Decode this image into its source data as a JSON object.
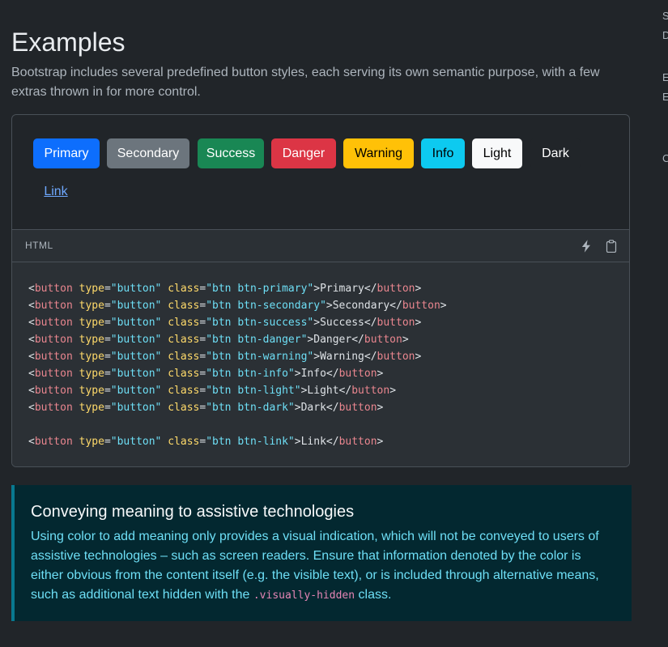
{
  "heading": "Examples",
  "lead": "Bootstrap includes several predefined button styles, each serving its own semantic purpose, with a few extras thrown in for more control.",
  "buttons": {
    "primary": "Primary",
    "secondary": "Secondary",
    "success": "Success",
    "danger": "Danger",
    "warning": "Warning",
    "info": "Info",
    "light": "Light",
    "dark": "Dark",
    "link": "Link"
  },
  "code_header": {
    "language": "HTML",
    "icons": [
      "lightning-icon",
      "clipboard-icon"
    ]
  },
  "code_lines": [
    {
      "cls": "btn btn-primary",
      "label": "Primary"
    },
    {
      "cls": "btn btn-secondary",
      "label": "Secondary"
    },
    {
      "cls": "btn btn-success",
      "label": "Success"
    },
    {
      "cls": "btn btn-danger",
      "label": "Danger"
    },
    {
      "cls": "btn btn-warning",
      "label": "Warning"
    },
    {
      "cls": "btn btn-info",
      "label": "Info"
    },
    {
      "cls": "btn btn-light",
      "label": "Light"
    },
    {
      "cls": "btn btn-dark",
      "label": "Dark"
    },
    {
      "cls": "btn btn-link",
      "label": "Link",
      "gap_before": true
    }
  ],
  "callout": {
    "title": "Conveying meaning to assistive technologies",
    "text_before": "Using color to add meaning only provides a visual indication, which will not be conveyed to users of assistive technologies – such as screen readers. Ensure that information denoted by the color is either obvious from the content itself (e.g. the visible text), or is included through alternative means, such as additional text hidden with the ",
    "code": ".visually-hidden",
    "text_after": " class."
  },
  "sidebar_peek": [
    "S",
    "D",
    "E",
    "E",
    "C"
  ],
  "colors": {
    "background": "#212529",
    "primary": "#0d6efd",
    "secondary": "#6c757d",
    "success": "#198754",
    "danger": "#dc3545",
    "warning": "#ffc107",
    "info": "#0dcaf0",
    "light": "#f8f9fa",
    "link": "#6ea8fe",
    "callout_bg": "#032830",
    "callout_border": "#087990"
  }
}
